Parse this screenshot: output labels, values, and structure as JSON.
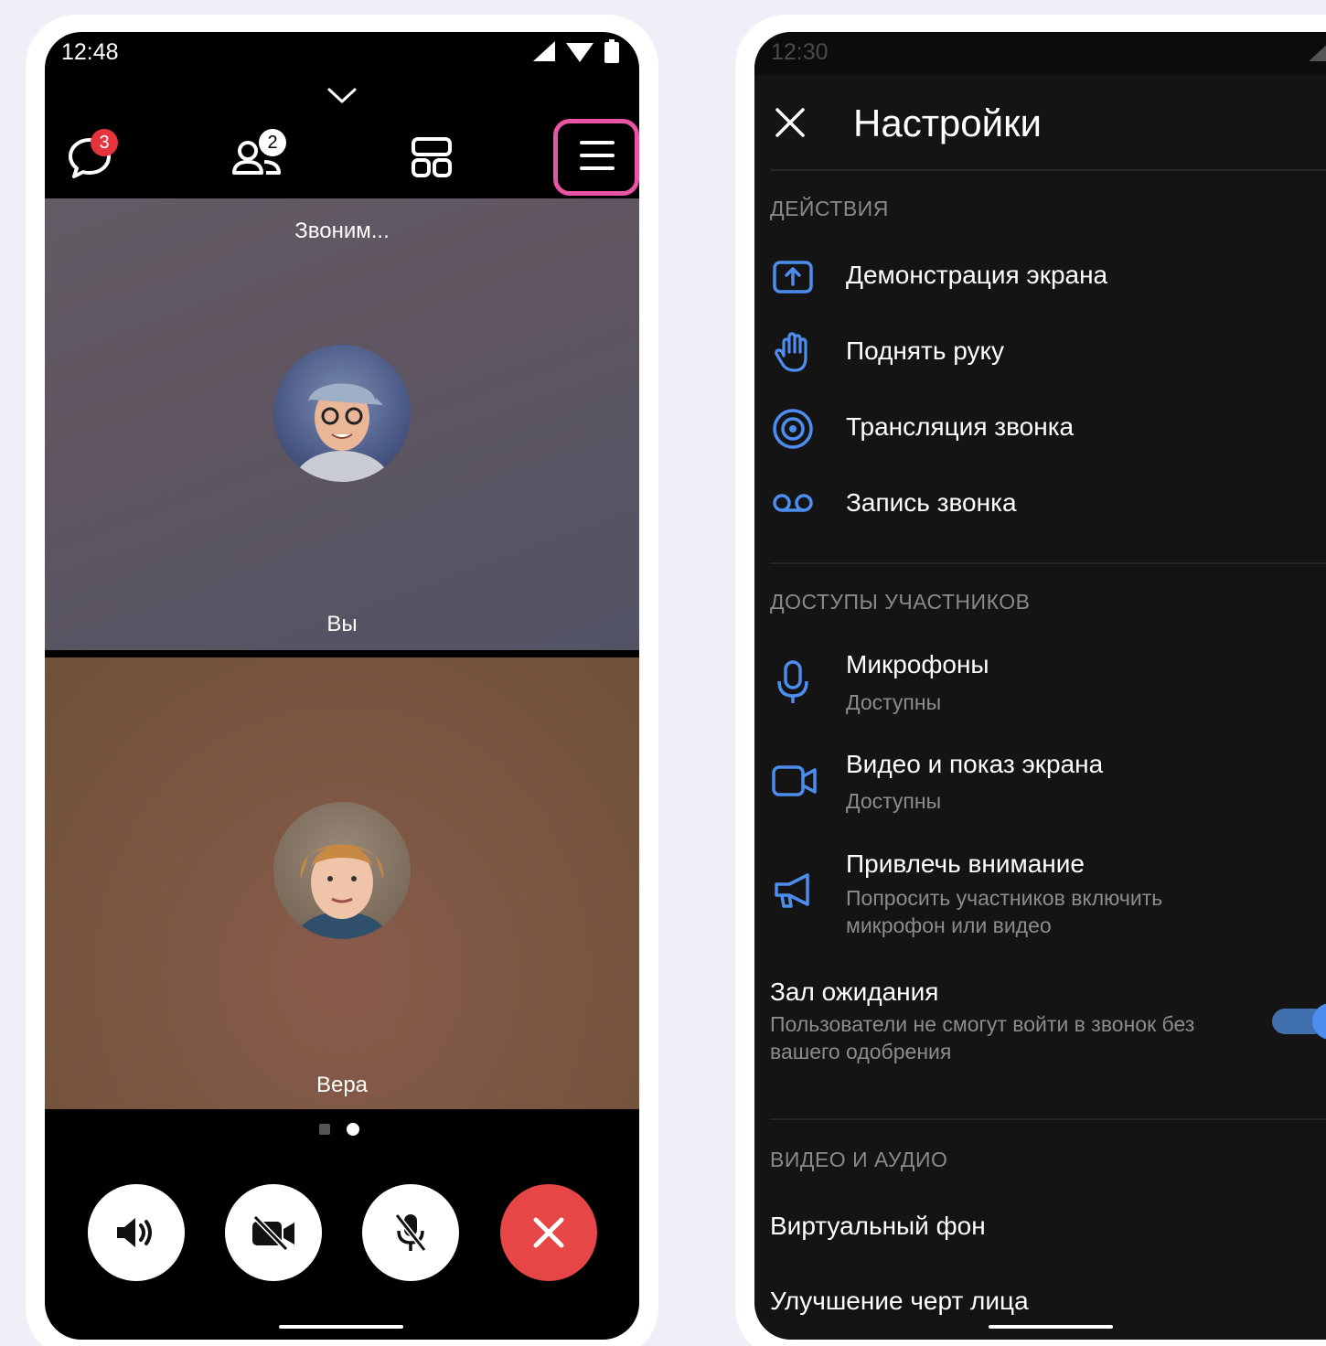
{
  "colors": {
    "accent": "#4d8df0",
    "highlight": "#e855a4",
    "badge": "#e6343f",
    "end_call": "#e64646"
  },
  "call_screen": {
    "status_time": "12:48",
    "toolbar": {
      "chat_badge": "3",
      "participants_badge": "2",
      "icons": [
        "chat-icon",
        "participants-icon",
        "layout-icon",
        "menu-icon"
      ]
    },
    "calling_text": "Звоним...",
    "tiles": [
      {
        "name": "Вы"
      },
      {
        "name": "Вера"
      }
    ],
    "page_indicator": {
      "pages": 2,
      "active": 2
    },
    "controls": [
      "speaker-icon",
      "camera-off-icon",
      "mic-off-icon",
      "end-call-icon"
    ]
  },
  "settings_screen": {
    "status_time": "12:30",
    "title": "Настройки",
    "sections": {
      "actions": "ДЕЙСТВИЯ",
      "participants": "ДОСТУПЫ УЧАСТНИКОВ",
      "video_audio": "ВИДЕО И АУДИО"
    },
    "actions": {
      "screen_share": "Демонстрация экрана",
      "raise_hand": "Поднять руку",
      "broadcast": "Трансляция звонка",
      "record": "Запись звонка"
    },
    "access": {
      "mics_label": "Микрофоны",
      "mics_sub": "Доступны",
      "video_label": "Видео и показ экрана",
      "video_sub": "Доступны",
      "attention_label": "Привлечь внимание",
      "attention_sub": "Попросить участников включить микрофон или видео",
      "waiting_label": "Зал ожидания",
      "waiting_sub": "Пользователи не смогут войти в звонок без вашего одобрения",
      "waiting_enabled": true
    },
    "video_audio": {
      "virtual_bg": "Виртуальный фон",
      "face_enhance": "Улучшение черт лица"
    }
  }
}
